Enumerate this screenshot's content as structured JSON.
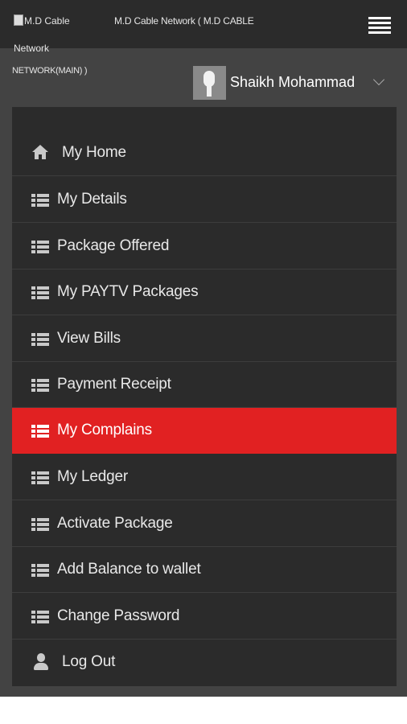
{
  "header": {
    "logo_alt_line1": "M.D Cable",
    "logo_alt_line2": "Network",
    "company_line1": "M.D Cable Network ( M.D CABLE",
    "company_line2": "NETWORK(MAIN) )",
    "menu_icon": "hamburger-menu-icon"
  },
  "user": {
    "name": "Shaikh Mohammad",
    "avatar_icon": "user-avatar-icon",
    "dropdown_icon": "chevron-down-icon"
  },
  "menu": {
    "items": [
      {
        "label": "My Home",
        "icon": "home-icon"
      },
      {
        "label": "My Details",
        "icon": "list-icon"
      },
      {
        "label": "Package Offered",
        "icon": "list-icon"
      },
      {
        "label": "My PAYTV Packages",
        "icon": "list-icon"
      },
      {
        "label": "View Bills",
        "icon": "list-icon"
      },
      {
        "label": "Payment Receipt",
        "icon": "list-icon"
      },
      {
        "label": "My Complains",
        "icon": "list-icon",
        "active": true
      },
      {
        "label": "My Ledger",
        "icon": "list-icon"
      },
      {
        "label": "Activate Package",
        "icon": "list-icon"
      },
      {
        "label": "Add Balance to wallet",
        "icon": "list-icon"
      },
      {
        "label": "Change Password",
        "icon": "list-icon"
      },
      {
        "label": "Log Out",
        "icon": "user-icon"
      }
    ]
  },
  "colors": {
    "active_item": "#e12122",
    "menu_background": "#2b2b2b",
    "page_background": "#434343"
  }
}
